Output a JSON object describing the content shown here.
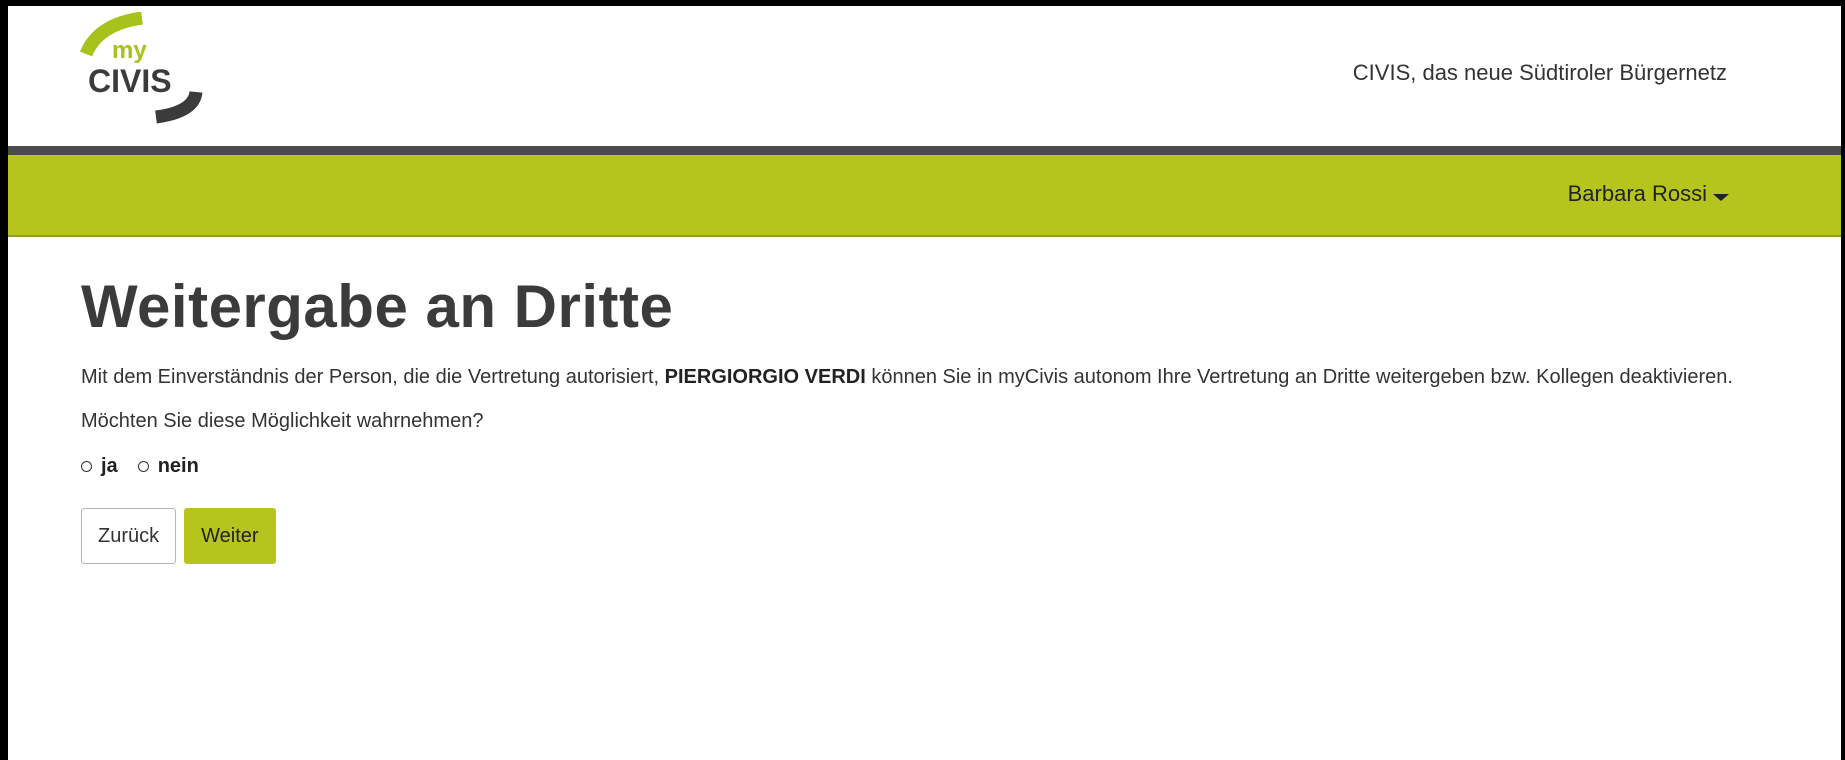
{
  "header": {
    "logo_text_top": "my",
    "logo_text_main": "CIVIS",
    "tagline": "CIVIS, das neue Südtiroler Bürgernetz"
  },
  "navbar": {
    "user_name": "Barbara Rossi",
    "user_caret_icon": "caret-down-icon"
  },
  "main": {
    "title": "Weitergabe an Dritte",
    "intro_before": "Mit dem Einverständnis der Person, die die Vertretung autorisiert, ",
    "intro_name": "PIERGIORGIO VERDI",
    "intro_after": " können Sie in myCivis autonom Ihre Vertretung an Dritte weitergeben bzw. Kollegen deaktivieren.",
    "question": "Möchten Sie diese Möglichkeit wahrnehmen?",
    "options": [
      {
        "label": "ja",
        "selected": false
      },
      {
        "label": "nein",
        "selected": false
      }
    ],
    "back_label": "Zurück",
    "next_label": "Weiter"
  },
  "colors": {
    "accent_green": "#b5c51e",
    "dark_bar": "#4a4a4a",
    "text": "#333333"
  }
}
